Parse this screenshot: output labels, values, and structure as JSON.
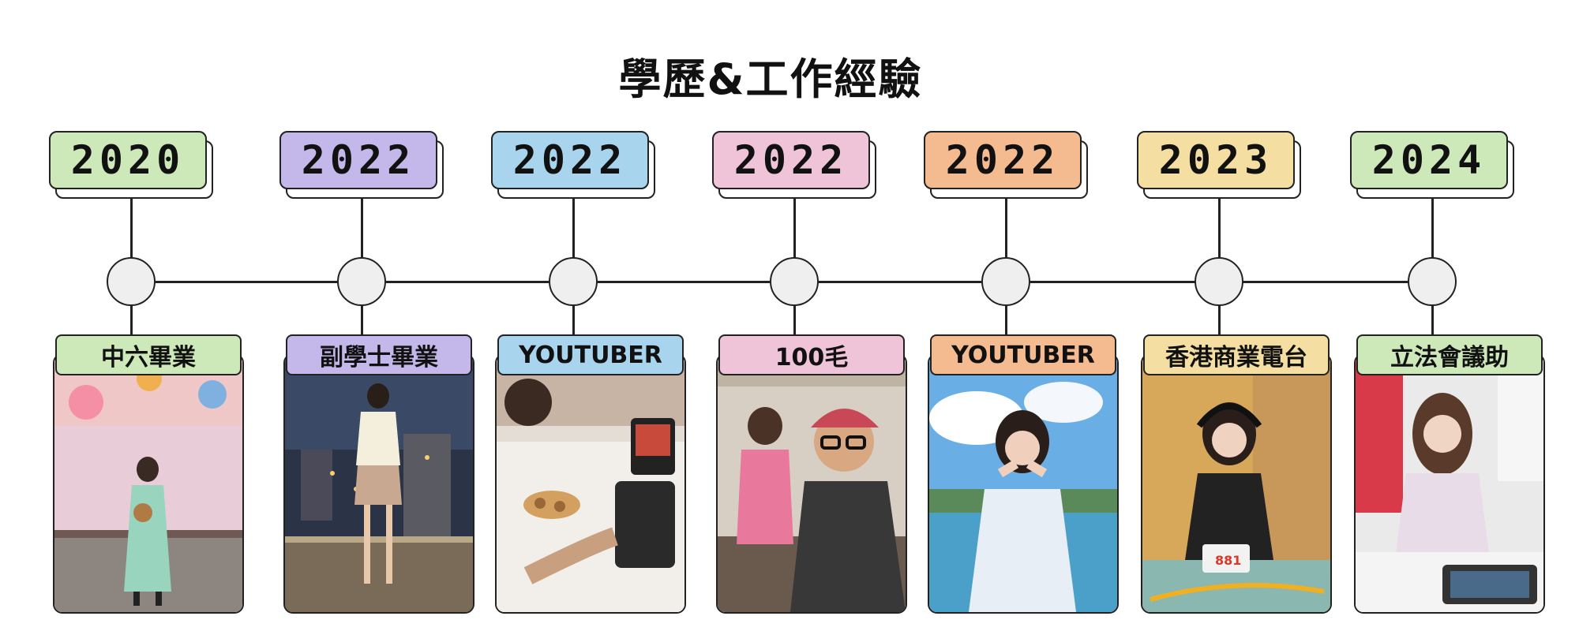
{
  "title": "學歷&工作經驗",
  "milestones": [
    {
      "year": "2020",
      "role": "中六畢業",
      "color": "#cde8b9"
    },
    {
      "year": "2022",
      "role": "副學士畢業",
      "color": "#c4b8ea"
    },
    {
      "year": "2022",
      "role": "YOUTUBER",
      "color": "#a9d4ee"
    },
    {
      "year": "2022",
      "role": "100毛",
      "color": "#efc3d8"
    },
    {
      "year": "2022",
      "role": "YOUTUBER",
      "color": "#f5bb90"
    },
    {
      "year": "2023",
      "role": "香港商業電台",
      "color": "#f4dea2"
    },
    {
      "year": "2024",
      "role": "立法會議助",
      "color": "#cde8b9"
    }
  ]
}
